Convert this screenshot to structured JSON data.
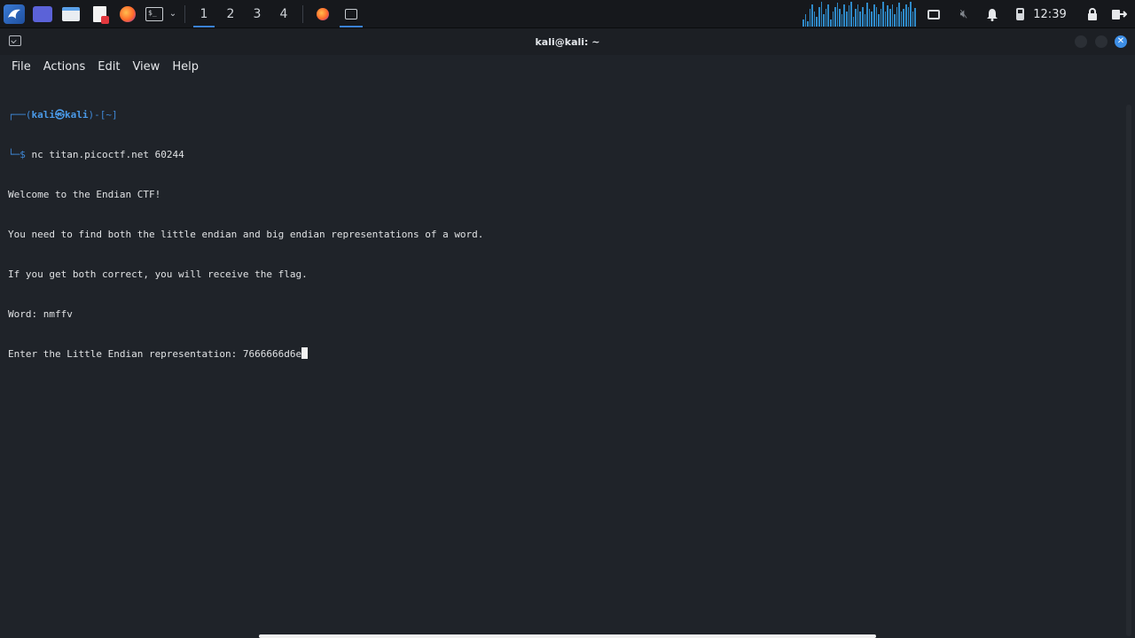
{
  "panel": {
    "workspaces": [
      "1",
      "2",
      "3",
      "4"
    ],
    "active_workspace": "1",
    "clock": "12:39",
    "accent_color": "#3b82d6",
    "cpu_history": [
      0.3,
      0.5,
      0.2,
      0.7,
      0.9,
      0.6,
      0.4,
      0.8,
      1.0,
      0.5,
      0.7,
      0.9,
      0.3,
      0.6,
      0.8,
      0.95,
      0.7,
      0.5,
      0.9,
      0.6,
      0.85,
      1.0,
      0.4,
      0.7,
      0.9,
      0.6,
      0.8,
      0.5,
      0.95,
      0.7,
      0.6,
      0.9,
      0.8,
      0.5,
      0.7,
      1.0,
      0.6,
      0.85,
      0.7,
      0.9,
      0.5,
      0.8,
      0.95,
      0.6,
      0.7,
      0.9,
      0.8,
      1.0,
      0.6,
      0.75
    ]
  },
  "window": {
    "title": "kali@kali: ~"
  },
  "menubar": {
    "file": "File",
    "actions": "Actions",
    "edit": "Edit",
    "view": "View",
    "help": "Help"
  },
  "terminal": {
    "prompt_line1_open": "┌──(",
    "prompt_user": "kali㉿kali",
    "prompt_line1_close": ")-[~]",
    "prompt_line2": "└─$ ",
    "command": "nc titan.picoctf.net 60244",
    "output": [
      "Welcome to the Endian CTF!",
      "You need to find both the little endian and big endian representations of a word.",
      "If you get both correct, you will receive the flag.",
      "Word: nmffv"
    ],
    "input_prompt": "Enter the Little Endian representation: ",
    "input_value": "7666666d6e"
  }
}
